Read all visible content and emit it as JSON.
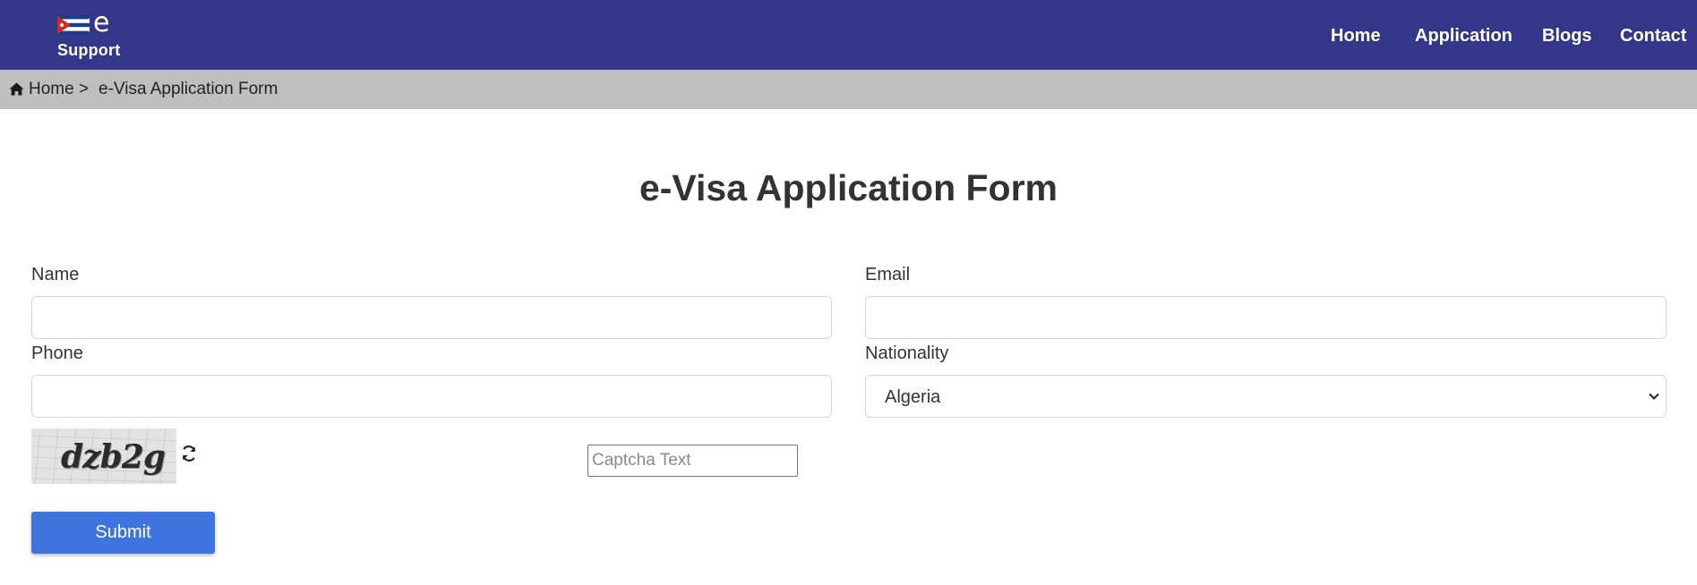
{
  "header": {
    "logo_letter": "e",
    "logo_subtitle": "Support",
    "nav": [
      "Home",
      "Application",
      "Blogs",
      "Contact"
    ],
    "bg_color": "#333689"
  },
  "breadcrumb": {
    "home_icon": "home-icon",
    "home": "Home",
    "separator": ">",
    "current": "e-Visa Application Form"
  },
  "page": {
    "title": "e-Visa Application Form"
  },
  "form": {
    "name_label": "Name",
    "name_value": "",
    "email_label": "Email",
    "email_value": "",
    "phone_label": "Phone",
    "phone_value": "",
    "nationality_label": "Nationality",
    "nationality_value": "Algeria",
    "captcha_code": "dzb2g",
    "refresh_icon": "refresh-icon",
    "captcha_placeholder": "Captcha Text",
    "submit_label": "Submit",
    "submit_color": "#3f73dd"
  }
}
